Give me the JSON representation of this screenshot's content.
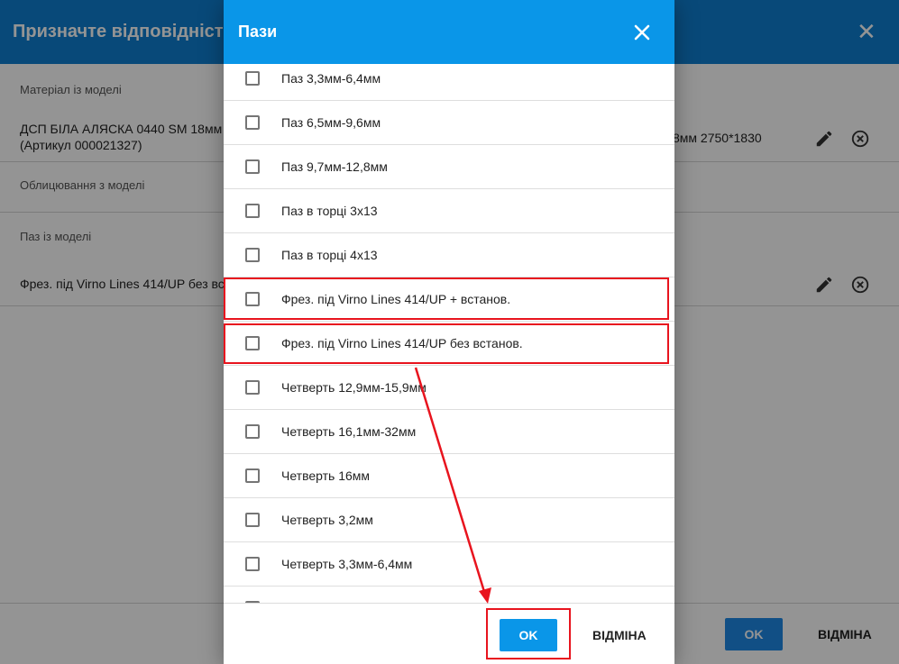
{
  "background": {
    "title": "Призначте відповідність",
    "sections": [
      {
        "label": "Матеріал із моделі",
        "value_line1": "ДСП БІЛА АЛЯСКА 0440 SM 18мм 2",
        "value_line2": "(Артикул 000021327)"
      },
      {
        "label": "Облицювання з моделі"
      },
      {
        "label": "Паз із моделі",
        "value_line1": "Фрез. під Virno Lines 414/UP без вс"
      }
    ],
    "matched_material": "8мм 2750*1830",
    "ok_label": "OK",
    "cancel_label": "ВІДМІНА",
    "icons": [
      "pencil-icon",
      "cancel-circle-icon"
    ]
  },
  "dialog": {
    "title": "Пази",
    "items": [
      "Паз 3,3мм-6,4мм",
      "Паз 6,5мм-9,6мм",
      "Паз 9,7мм-12,8мм",
      "Паз в торці 3х13",
      "Паз в торці 4х13",
      "Фрез. під Virno Lines 414/UP + встанов.",
      "Фрез. під Virno Lines 414/UP без встанов.",
      "Четверть 12,9мм-15,9мм",
      "Четверть 16,1мм-32мм",
      "Четверть 16мм",
      "Четверть 3,2мм",
      "Четверть 3,3мм-6,4мм"
    ],
    "ok_label": "OK",
    "cancel_label": "ВІДМІНА"
  },
  "colors": {
    "dialog_header": "#0a96e8",
    "background_header": "#0e7fd0",
    "annotation_red": "#e8141e"
  }
}
